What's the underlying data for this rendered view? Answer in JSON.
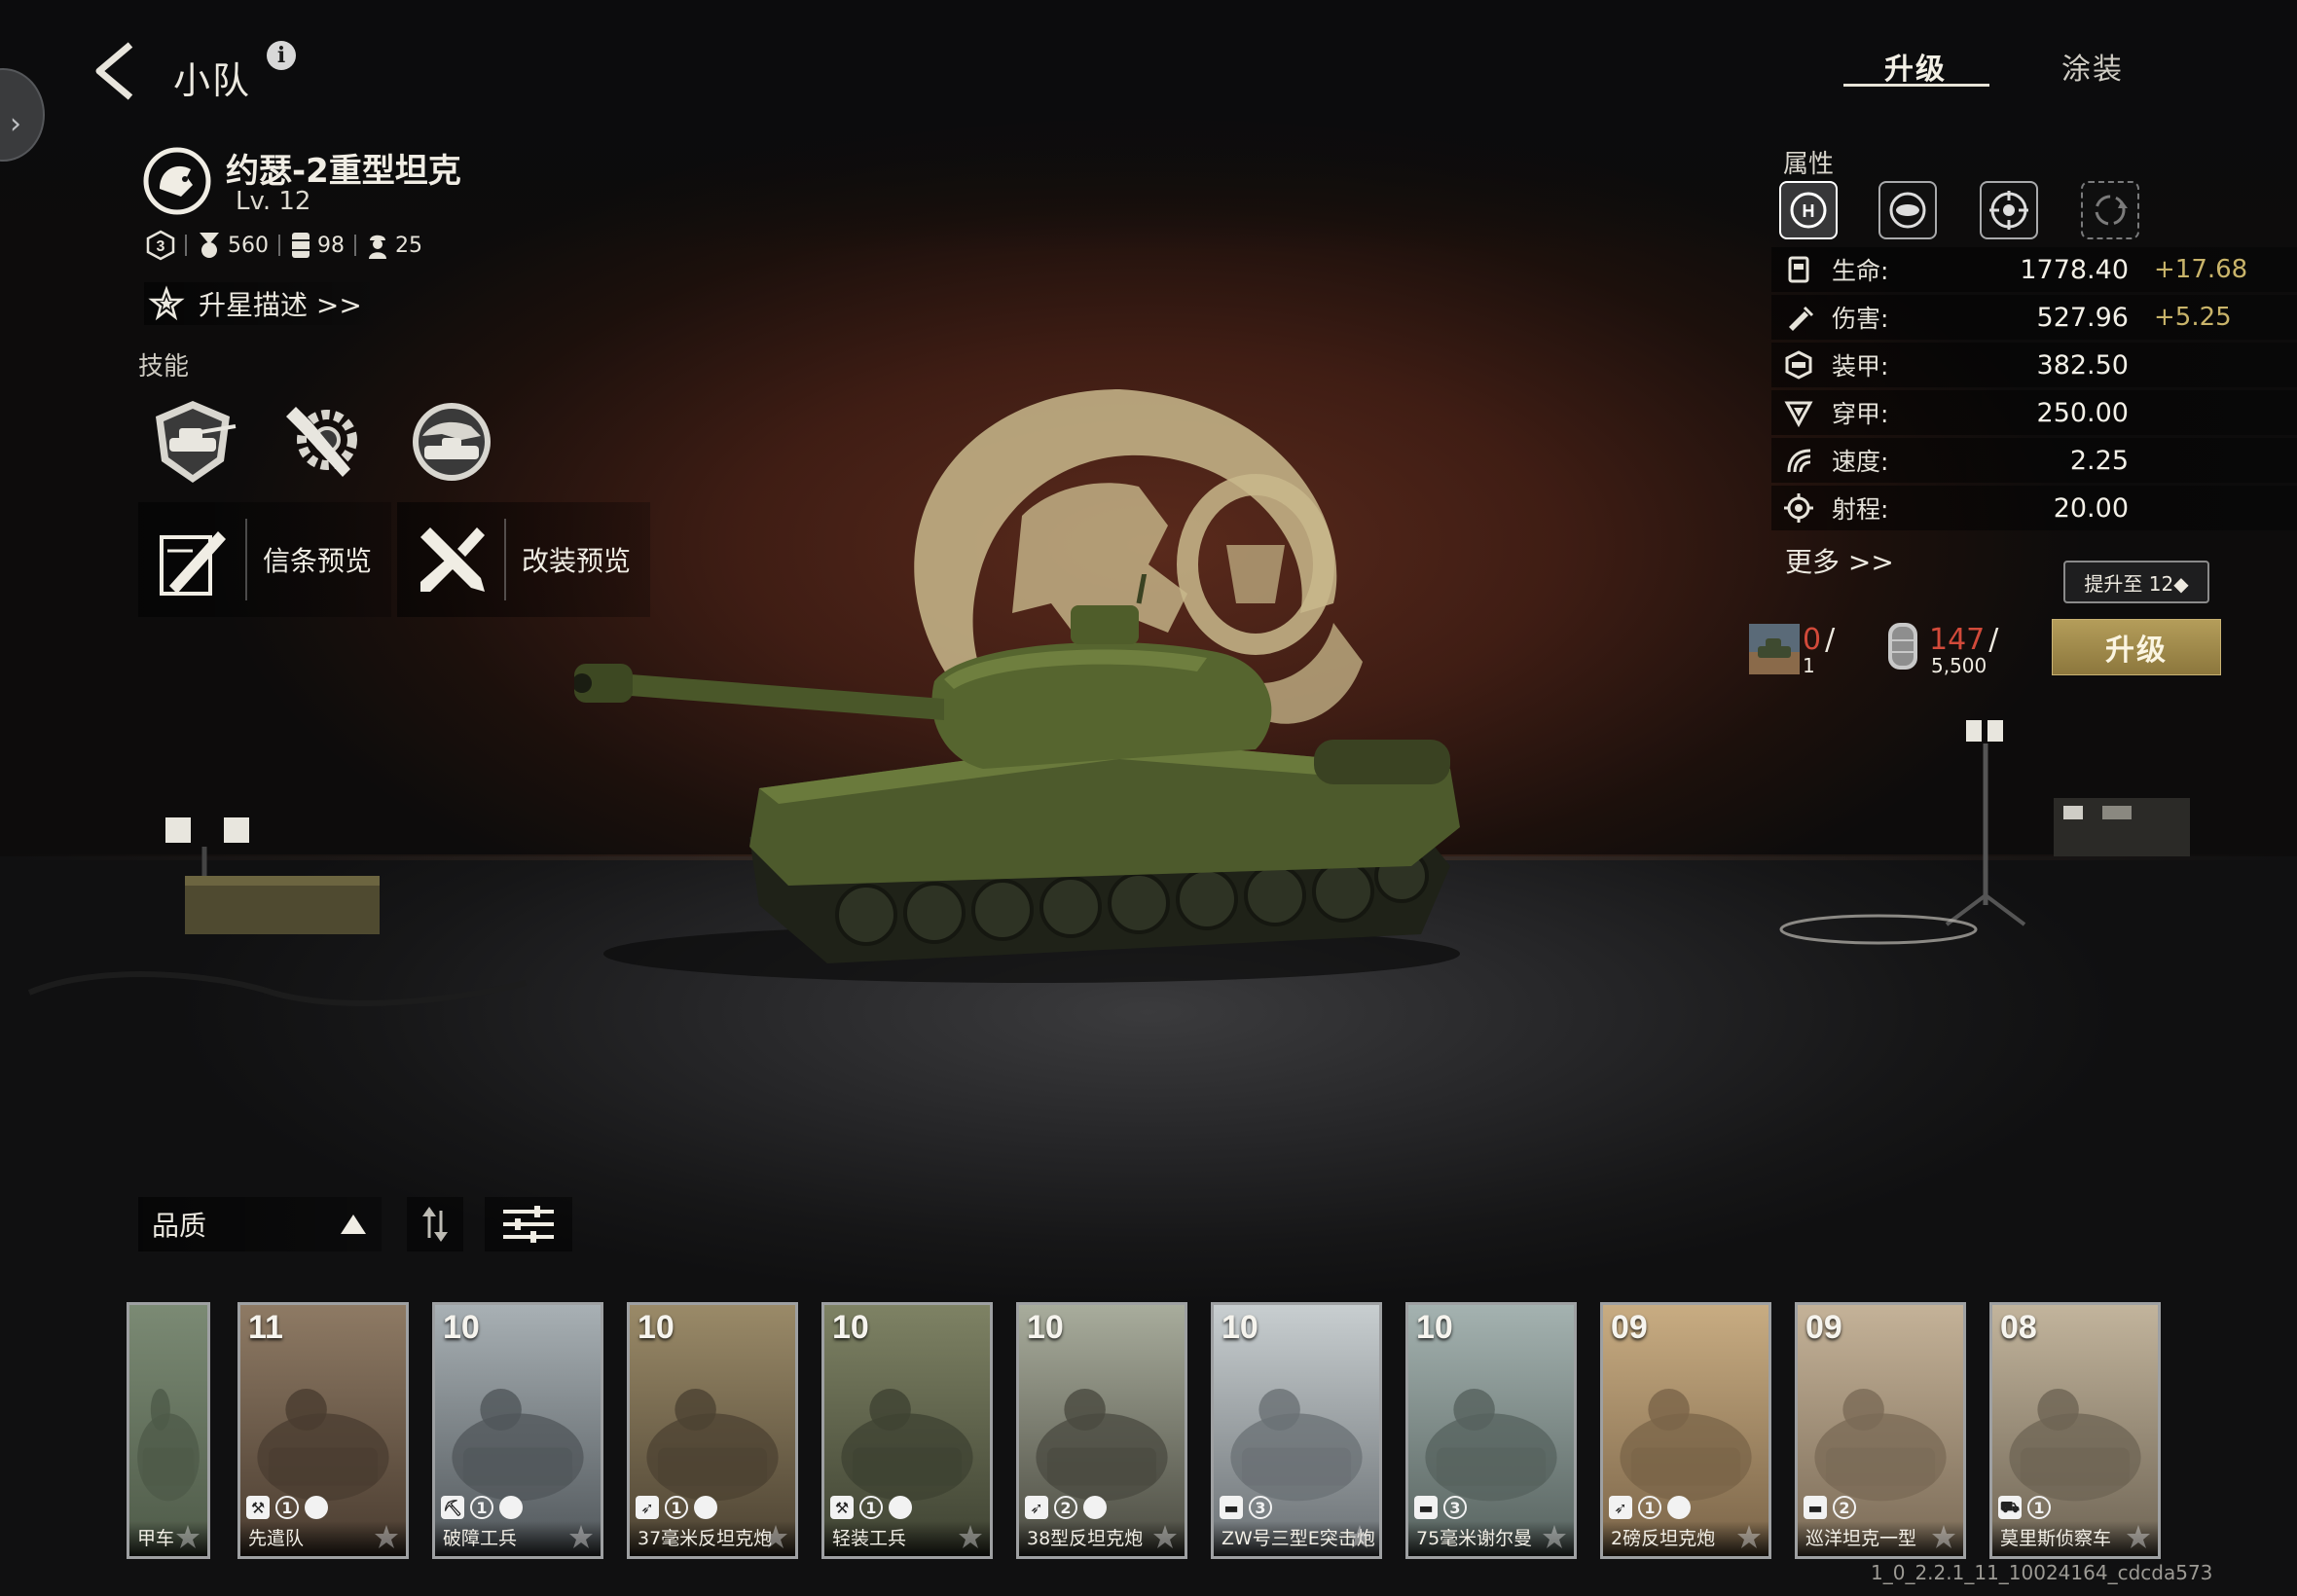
{
  "header": {
    "title": "小队",
    "info_glyph": "i"
  },
  "unit": {
    "name": "约瑟-2重型坦克",
    "level": "Lv. 12",
    "tier": "3",
    "resources": [
      {
        "icon": "medal-icon",
        "value": "560"
      },
      {
        "icon": "fuel-barrel-icon",
        "value": "98"
      },
      {
        "icon": "soldier-icon",
        "value": "25"
      }
    ],
    "star_link": "升星描述 >>"
  },
  "skills_label": "技能",
  "skills": [
    {
      "icon": "tank-badge-skill-icon"
    },
    {
      "icon": "wrench-gear-skill-icon"
    },
    {
      "icon": "tank-globe-skill-icon"
    }
  ],
  "previews": [
    {
      "icon": "letter-scroll-icon",
      "label": "信条预览"
    },
    {
      "icon": "crossed-tools-icon",
      "label": "改装预览"
    }
  ],
  "tabs": [
    {
      "label": "升级",
      "active": true
    },
    {
      "label": "涂装",
      "active": false
    }
  ],
  "attributes": {
    "title": "属性",
    "tabs": [
      "health-shield-icon",
      "armor-target-icon",
      "crosshair-icon",
      "rotate-icon"
    ],
    "stats": [
      {
        "icon": "fuel-can-icon",
        "label": "生命:",
        "value": "1778.40",
        "bonus": "+17.68"
      },
      {
        "icon": "syringe-icon",
        "label": "伤害:",
        "value": "527.96",
        "bonus": "+5.25"
      },
      {
        "icon": "armor-icon",
        "label": "装甲:",
        "value": "382.50",
        "bonus": ""
      },
      {
        "icon": "penetration-icon",
        "label": "穿甲:",
        "value": "250.00",
        "bonus": ""
      },
      {
        "icon": "speed-icon",
        "label": "速度:",
        "value": "2.25",
        "bonus": ""
      },
      {
        "icon": "range-icon",
        "label": "射程:",
        "value": "20.00",
        "bonus": ""
      }
    ],
    "more": "更多 >>"
  },
  "upgrade": {
    "tip": "提升至 12◆",
    "button": "升级",
    "costs": [
      {
        "icon": "tank-card-icon",
        "have": "0",
        "slash": "/",
        "need": "1"
      },
      {
        "icon": "supply-token-icon",
        "have": "147",
        "slash": "/",
        "need": "5,500"
      }
    ]
  },
  "filter": {
    "sort_label": "品质"
  },
  "cards": [
    {
      "level": "",
      "name": "装甲车",
      "name_visible": "甲车",
      "badges": [],
      "palette": [
        "#4e5a48",
        "#7b8a74"
      ]
    },
    {
      "level": "11",
      "name": "先遣队",
      "badges": [
        "wrench",
        "1",
        "flag"
      ],
      "palette": [
        "#4a3c30",
        "#8e7a64"
      ]
    },
    {
      "level": "10",
      "name": "破障工兵",
      "badges": [
        "pick",
        "1",
        "flag"
      ],
      "palette": [
        "#50565a",
        "#a8b0b4"
      ]
    },
    {
      "level": "10",
      "name": "37毫米反坦克炮",
      "badges": [
        "gun",
        "1",
        "flag"
      ],
      "palette": [
        "#4c4232",
        "#9a8a68"
      ]
    },
    {
      "level": "10",
      "name": "轻装工兵",
      "badges": [
        "wrench",
        "1",
        "flag"
      ],
      "palette": [
        "#3e4232",
        "#7e8264"
      ]
    },
    {
      "level": "10",
      "name": "38型反坦克炮",
      "badges": [
        "gun",
        "2",
        "flag"
      ],
      "palette": [
        "#4a4a40",
        "#a8ac9c"
      ]
    },
    {
      "level": "10",
      "name": "ZW号三型E突击炮",
      "badges": [
        "tank",
        "3"
      ],
      "palette": [
        "#6a7074",
        "#c8ced0"
      ]
    },
    {
      "level": "10",
      "name": "75毫米谢尔曼",
      "badges": [
        "tank",
        "3"
      ],
      "palette": [
        "#56625e",
        "#a4b2b0"
      ]
    },
    {
      "level": "09",
      "name": "2磅反坦克炮",
      "badges": [
        "gun",
        "1",
        "flag"
      ],
      "palette": [
        "#7a6448",
        "#c8ac82"
      ]
    },
    {
      "level": "09",
      "name": "巡洋坦克一型",
      "badges": [
        "tank",
        "2"
      ],
      "palette": [
        "#7a6a56",
        "#c4b298"
      ]
    },
    {
      "level": "08",
      "name": "莫里斯侦察车",
      "badges": [
        "car",
        "1"
      ],
      "palette": [
        "#6e6454",
        "#c2b49c"
      ]
    }
  ],
  "build_id": "1_0_2.2.1_11_10024164_cdcda573",
  "colors": {
    "accent_gold": "#b49d5a",
    "bonus_text": "#c9b46a",
    "shortfall_red": "#d24a3a"
  }
}
